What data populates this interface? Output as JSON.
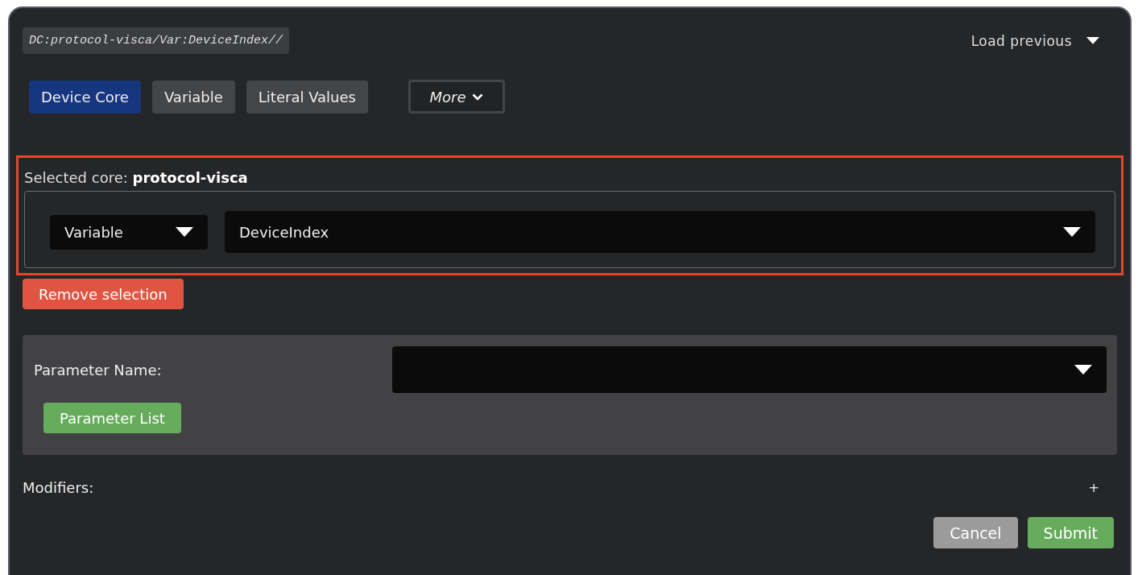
{
  "path": "DC:protocol-visca/Var:DeviceIndex//",
  "load_previous": {
    "label": "Load previous"
  },
  "tabs": [
    {
      "label": "Device Core",
      "selected": true
    },
    {
      "label": "Variable",
      "selected": false
    },
    {
      "label": "Literal Values",
      "selected": false
    }
  ],
  "more": {
    "label": "More"
  },
  "selection": {
    "highlighted": true,
    "label": "Selected core:",
    "core": "protocol-visca",
    "type_select": {
      "value": "Variable"
    },
    "value_select": {
      "value": "DeviceIndex"
    }
  },
  "remove_button": "Remove selection",
  "parameter": {
    "label": "Parameter Name:",
    "button": "Parameter List"
  },
  "modifiers": {
    "label": "Modifiers:",
    "add": "+"
  },
  "buttons": [
    {
      "label": "Cancel",
      "kind": "secondary"
    },
    {
      "label": "Submit",
      "kind": "primary"
    }
  ]
}
